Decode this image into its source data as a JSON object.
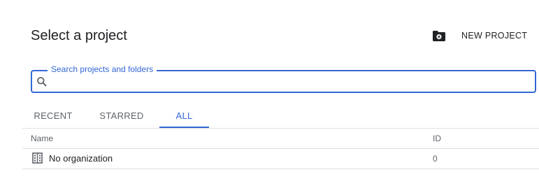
{
  "dialog": {
    "title": "Select a project",
    "new_project_label": "NEW PROJECT",
    "new_project_icon": "new-folder-gear-icon"
  },
  "search": {
    "label": "Search projects and folders",
    "value": "",
    "placeholder": "",
    "icon": "search-icon"
  },
  "tabs": [
    {
      "label": "RECENT",
      "active": false
    },
    {
      "label": "STARRED",
      "active": false
    },
    {
      "label": "ALL",
      "active": true
    }
  ],
  "table": {
    "columns": [
      "Name",
      "ID"
    ],
    "rows": [
      {
        "icon": "organization-building-icon",
        "name": "No organization",
        "id": "0"
      }
    ]
  },
  "colors": {
    "accent": "#3367d6",
    "text": "#202124",
    "secondary_text": "#5f6368",
    "divider": "#e0e0e0"
  }
}
